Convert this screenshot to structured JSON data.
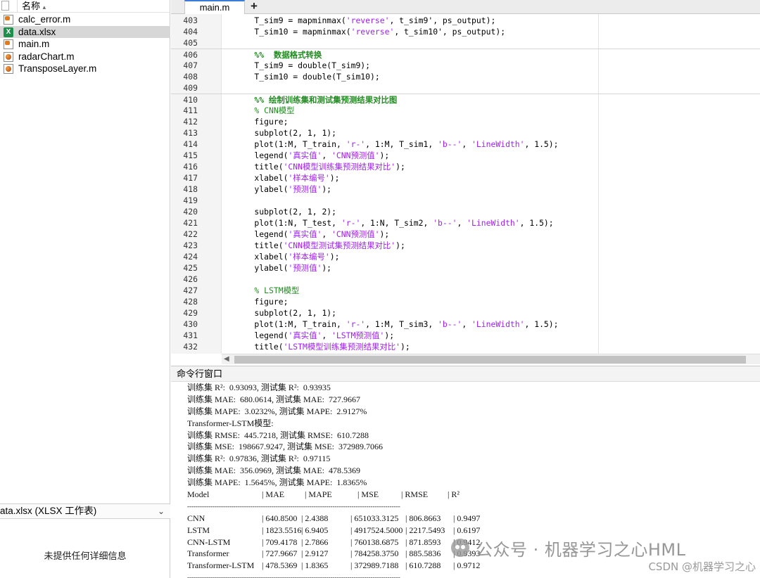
{
  "file_browser": {
    "column_name": "名称",
    "sort_indicator": "▴",
    "files": [
      {
        "name": "calc_error.m",
        "icon": "m-file-icon",
        "selected": false
      },
      {
        "name": "data.xlsx",
        "icon": "excel-file-icon",
        "selected": true
      },
      {
        "name": "main.m",
        "icon": "m-file-icon",
        "selected": false
      },
      {
        "name": "radarChart.m",
        "icon": "mlx-file-icon",
        "selected": false
      },
      {
        "name": "TransposeLayer.m",
        "icon": "mlx-file-icon",
        "selected": false
      }
    ],
    "detail_title": "ata.xlsx  (XLSX 工作表)",
    "detail_chevron": "⌄",
    "detail_empty": "未提供任何详细信息"
  },
  "editor": {
    "tab_label": "main.m",
    "add_tab": "+",
    "lines": [
      {
        "n": "403",
        "sep": false,
        "seg": [
          [
            "p",
            "    T_sim9 = mapminmax("
          ],
          [
            "s",
            "'reverse'"
          ],
          [
            "p",
            ", t_sim9', ps_output);"
          ]
        ]
      },
      {
        "n": "404",
        "sep": false,
        "seg": [
          [
            "p",
            "    T_sim10 = mapminmax("
          ],
          [
            "s",
            "'reverse'"
          ],
          [
            "p",
            ", t_sim10', ps_output);"
          ]
        ]
      },
      {
        "n": "405",
        "sep": false,
        "seg": [
          [
            "p",
            ""
          ]
        ]
      },
      {
        "n": "406",
        "sep": true,
        "seg": [
          [
            "h",
            "    %%  数据格式转换"
          ]
        ]
      },
      {
        "n": "407",
        "sep": false,
        "seg": [
          [
            "p",
            "    T_sim9 = double(T_sim9);"
          ]
        ]
      },
      {
        "n": "408",
        "sep": false,
        "seg": [
          [
            "p",
            "    T_sim10 = double(T_sim10);"
          ]
        ]
      },
      {
        "n": "409",
        "sep": false,
        "seg": [
          [
            "p",
            ""
          ]
        ]
      },
      {
        "n": "410",
        "sep": true,
        "seg": [
          [
            "h",
            "    %% 绘制训练集和测试集预测结果对比图"
          ]
        ]
      },
      {
        "n": "411",
        "sep": false,
        "seg": [
          [
            "c",
            "    % CNN模型"
          ]
        ]
      },
      {
        "n": "412",
        "sep": false,
        "seg": [
          [
            "p",
            "    figure;"
          ]
        ]
      },
      {
        "n": "413",
        "sep": false,
        "seg": [
          [
            "p",
            "    subplot(2, 1, 1);"
          ]
        ]
      },
      {
        "n": "414",
        "sep": false,
        "seg": [
          [
            "p",
            "    plot(1:M, T_train, "
          ],
          [
            "s",
            "'r-'"
          ],
          [
            "p",
            ", 1:M, T_sim1, "
          ],
          [
            "s",
            "'b--'"
          ],
          [
            "p",
            ", "
          ],
          [
            "s",
            "'LineWidth'"
          ],
          [
            "p",
            ", 1.5);"
          ]
        ]
      },
      {
        "n": "415",
        "sep": false,
        "seg": [
          [
            "p",
            "    legend("
          ],
          [
            "s",
            "'真实值'"
          ],
          [
            "p",
            ", "
          ],
          [
            "s",
            "'CNN预测值'"
          ],
          [
            "p",
            ");"
          ]
        ]
      },
      {
        "n": "416",
        "sep": false,
        "seg": [
          [
            "p",
            "    title("
          ],
          [
            "s",
            "'CNN模型训练集预测结果对比'"
          ],
          [
            "p",
            ");"
          ]
        ]
      },
      {
        "n": "417",
        "sep": false,
        "seg": [
          [
            "p",
            "    xlabel("
          ],
          [
            "s",
            "'样本编号'"
          ],
          [
            "p",
            ");"
          ]
        ]
      },
      {
        "n": "418",
        "sep": false,
        "seg": [
          [
            "p",
            "    ylabel("
          ],
          [
            "s",
            "'预测值'"
          ],
          [
            "p",
            ");"
          ]
        ]
      },
      {
        "n": "419",
        "sep": false,
        "seg": [
          [
            "p",
            ""
          ]
        ]
      },
      {
        "n": "420",
        "sep": false,
        "seg": [
          [
            "p",
            "    subplot(2, 1, 2);"
          ]
        ]
      },
      {
        "n": "421",
        "sep": false,
        "seg": [
          [
            "p",
            "    plot(1:N, T_test, "
          ],
          [
            "s",
            "'r-'"
          ],
          [
            "p",
            ", 1:N, T_sim2, "
          ],
          [
            "s",
            "'b--'"
          ],
          [
            "p",
            ", "
          ],
          [
            "s",
            "'LineWidth'"
          ],
          [
            "p",
            ", 1.5);"
          ]
        ]
      },
      {
        "n": "422",
        "sep": false,
        "seg": [
          [
            "p",
            "    legend("
          ],
          [
            "s",
            "'真实值'"
          ],
          [
            "p",
            ", "
          ],
          [
            "s",
            "'CNN预测值'"
          ],
          [
            "p",
            ");"
          ]
        ]
      },
      {
        "n": "423",
        "sep": false,
        "seg": [
          [
            "p",
            "    title("
          ],
          [
            "s",
            "'CNN模型测试集预测结果对比'"
          ],
          [
            "p",
            ");"
          ]
        ]
      },
      {
        "n": "424",
        "sep": false,
        "seg": [
          [
            "p",
            "    xlabel("
          ],
          [
            "s",
            "'样本编号'"
          ],
          [
            "p",
            ");"
          ]
        ]
      },
      {
        "n": "425",
        "sep": false,
        "seg": [
          [
            "p",
            "    ylabel("
          ],
          [
            "s",
            "'预测值'"
          ],
          [
            "p",
            ");"
          ]
        ]
      },
      {
        "n": "426",
        "sep": false,
        "seg": [
          [
            "p",
            ""
          ]
        ]
      },
      {
        "n": "427",
        "sep": false,
        "seg": [
          [
            "c",
            "    % LSTM模型"
          ]
        ]
      },
      {
        "n": "428",
        "sep": false,
        "seg": [
          [
            "p",
            "    figure;"
          ]
        ]
      },
      {
        "n": "429",
        "sep": false,
        "seg": [
          [
            "p",
            "    subplot(2, 1, 1);"
          ]
        ]
      },
      {
        "n": "430",
        "sep": false,
        "seg": [
          [
            "p",
            "    plot(1:M, T_train, "
          ],
          [
            "s",
            "'r-'"
          ],
          [
            "p",
            ", 1:M, T_sim3, "
          ],
          [
            "s",
            "'b--'"
          ],
          [
            "p",
            ", "
          ],
          [
            "s",
            "'LineWidth'"
          ],
          [
            "p",
            ", 1.5);"
          ]
        ]
      },
      {
        "n": "431",
        "sep": false,
        "seg": [
          [
            "p",
            "    legend("
          ],
          [
            "s",
            "'真实值'"
          ],
          [
            "p",
            ", "
          ],
          [
            "s",
            "'LSTM预测值'"
          ],
          [
            "p",
            ");"
          ]
        ]
      },
      {
        "n": "432",
        "sep": false,
        "seg": [
          [
            "p",
            "    title("
          ],
          [
            "s",
            "'LSTM模型训练集预测结果对比'"
          ],
          [
            "p",
            ");"
          ]
        ]
      }
    ]
  },
  "command_window": {
    "title": "命令行窗口",
    "output_lines": [
      "训练集 R²:  0.93093, 测试集 R²:  0.93935",
      "训练集 MAE:  680.0614, 测试集 MAE:  727.9667",
      "训练集 MAPE:  3.0232%, 测试集 MAPE:  2.9127%",
      "Transformer-LSTM模型:",
      "训练集 RMSE:  445.7218, 测试集 RMSE:  610.7288",
      "训练集 MSE:  198667.9247, 测试集 MSE:  372989.7066",
      "训练集 R²:  0.97836, 测试集 R²:  0.97115",
      "训练集 MAE:  356.0969, 测试集 MAE:  478.5369",
      "训练集 MAPE:  1.5645%, 测试集 MAPE:  1.8365%"
    ],
    "table_header": [
      "Model",
      "| MAE",
      "| MAPE",
      "| MSE",
      "| RMSE",
      "| R²"
    ],
    "table_divider": "-----------------------------------------------------------------------------------------------------",
    "table_rows": [
      [
        "CNN",
        "| 640.8500",
        "| 2.4388",
        "| 651033.3125",
        "| 806.8663",
        "| 0.9497"
      ],
      [
        "LSTM",
        "| 1823.5516",
        "| 6.9405",
        "| 4917524.5000",
        "| 2217.5493",
        "| 0.6197"
      ],
      [
        "CNN-LSTM",
        "| 709.4178",
        "| 2.7866",
        "| 760138.6875",
        "| 871.8593",
        "| 0.9412"
      ],
      [
        "Transformer",
        "| 727.9667",
        "| 2.9127",
        "| 784258.3750",
        "| 885.5836",
        "| 0.9393"
      ],
      [
        "Transformer-LSTM",
        "| 478.5369",
        "| 1.8365",
        "| 372989.7188",
        "| 610.7288",
        "| 0.9712"
      ]
    ],
    "table_bottom_divider": "-----------------------------------------------------------------------------------------------------"
  },
  "watermark": {
    "main": "公众号 · 机器学习之心HML",
    "csdn": "CSDN @机器学习之心"
  },
  "colors": {
    "string": "#a020f0",
    "comment": "#228b22",
    "tab_accent": "#3d7bd8",
    "selection": "#d7d7d7"
  }
}
